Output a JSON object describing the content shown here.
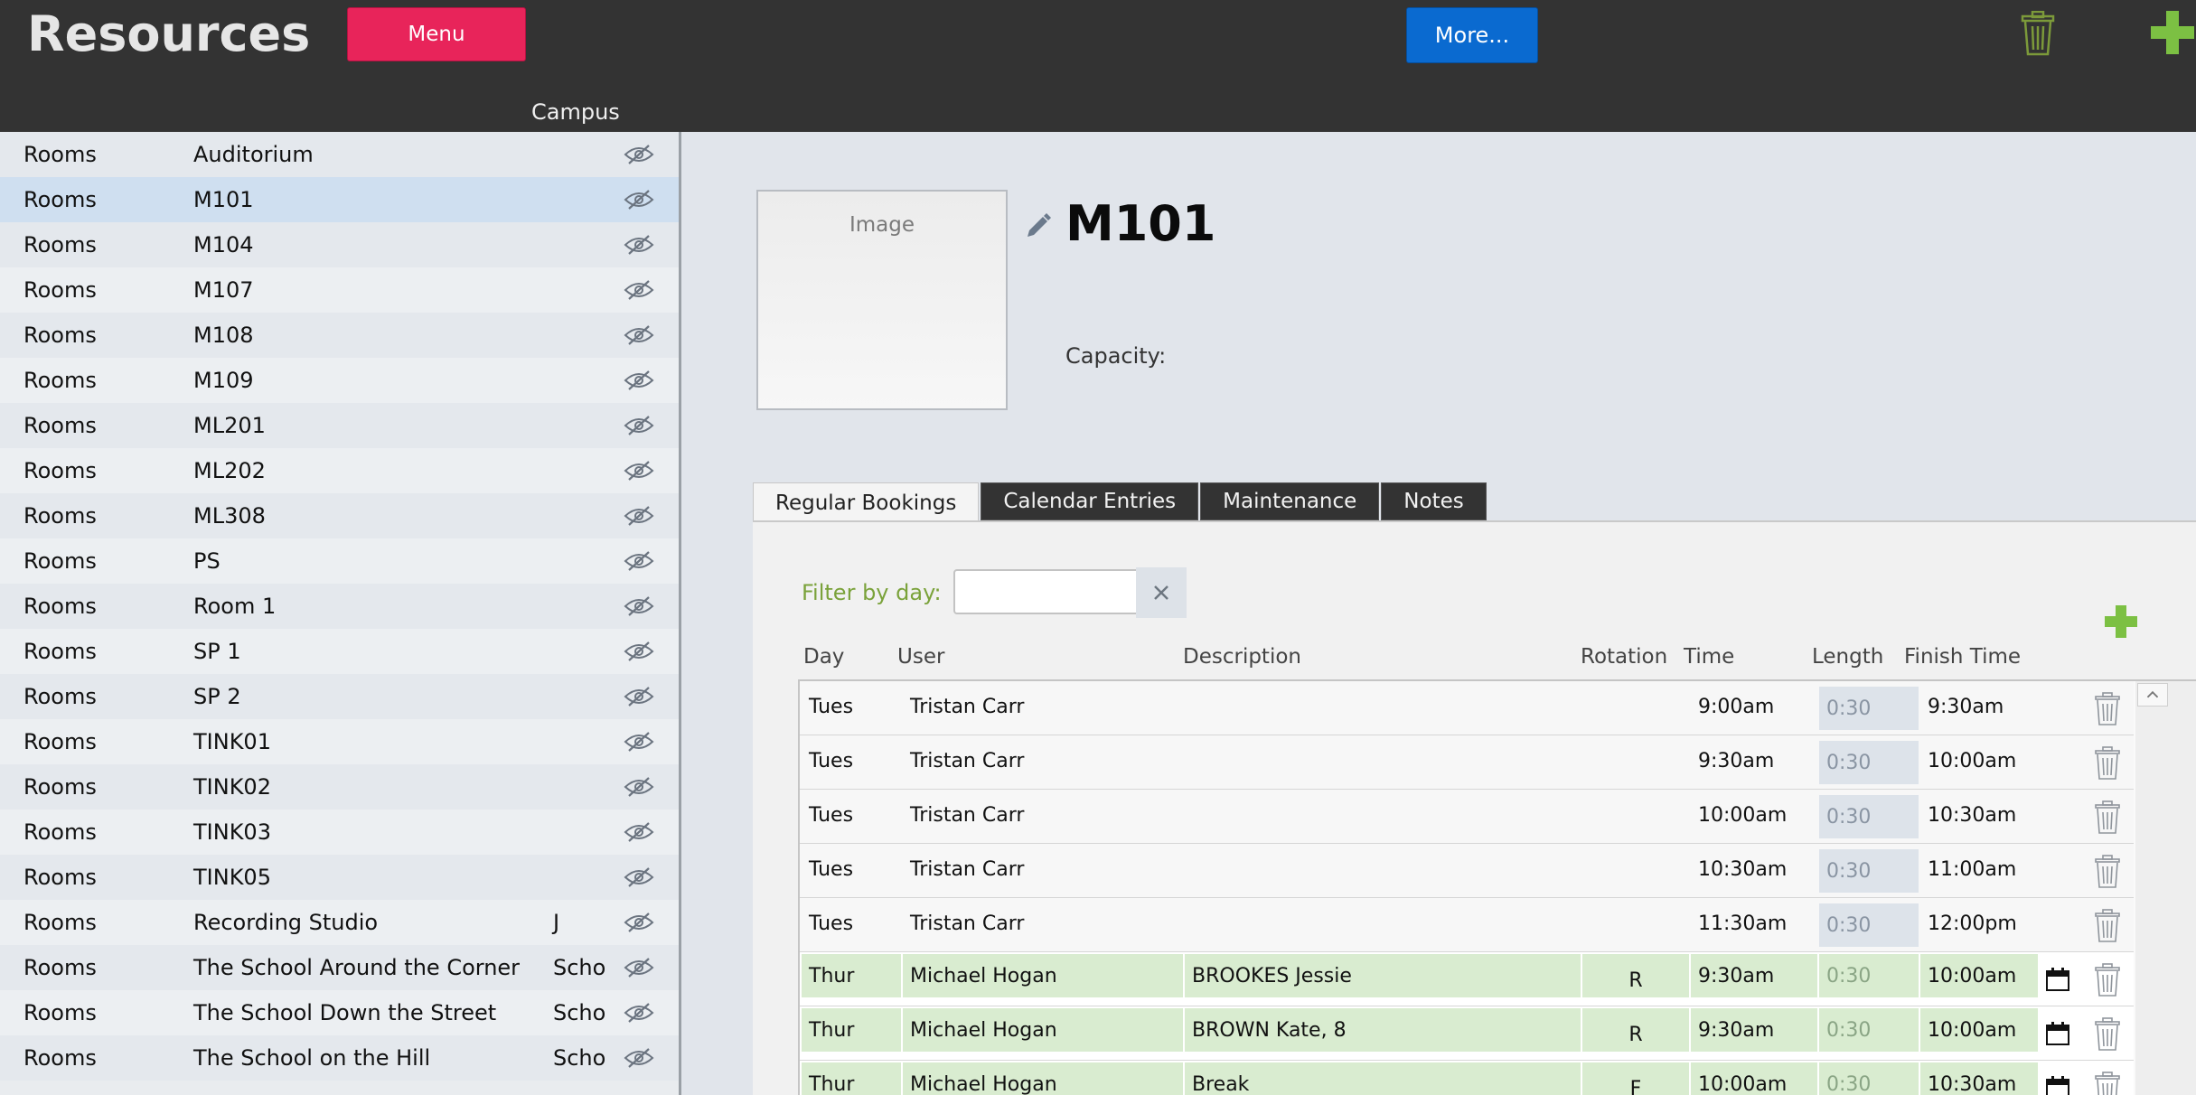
{
  "header": {
    "title": "Resources",
    "menu_label": "Menu",
    "more_label": "More...",
    "campus_column": "Campus",
    "colors": {
      "bar": "#333333",
      "menu": "#e8245a",
      "more": "#0a6ad0",
      "add": "#7cc043"
    }
  },
  "sidebar": {
    "items": [
      {
        "type": "Rooms",
        "name": "Auditorium",
        "campus": ""
      },
      {
        "type": "Rooms",
        "name": "M101",
        "campus": "",
        "selected": true
      },
      {
        "type": "Rooms",
        "name": "M104",
        "campus": ""
      },
      {
        "type": "Rooms",
        "name": "M107",
        "campus": ""
      },
      {
        "type": "Rooms",
        "name": "M108",
        "campus": ""
      },
      {
        "type": "Rooms",
        "name": "M109",
        "campus": ""
      },
      {
        "type": "Rooms",
        "name": "ML201",
        "campus": ""
      },
      {
        "type": "Rooms",
        "name": "ML202",
        "campus": ""
      },
      {
        "type": "Rooms",
        "name": "ML308",
        "campus": ""
      },
      {
        "type": "Rooms",
        "name": "PS",
        "campus": ""
      },
      {
        "type": "Rooms",
        "name": "Room 1",
        "campus": ""
      },
      {
        "type": "Rooms",
        "name": "SP 1",
        "campus": ""
      },
      {
        "type": "Rooms",
        "name": "SP 2",
        "campus": ""
      },
      {
        "type": "Rooms",
        "name": "TINK01",
        "campus": ""
      },
      {
        "type": "Rooms",
        "name": "TINK02",
        "campus": ""
      },
      {
        "type": "Rooms",
        "name": "TINK03",
        "campus": ""
      },
      {
        "type": "Rooms",
        "name": "TINK05",
        "campus": ""
      },
      {
        "type": "Rooms",
        "name": "Recording Studio",
        "campus": "J"
      },
      {
        "type": "Rooms",
        "name": "The School Around the Corner",
        "campus": "Scho"
      },
      {
        "type": "Rooms",
        "name": "The School Down the Street",
        "campus": "Scho"
      },
      {
        "type": "Rooms",
        "name": "The School on the Hill",
        "campus": "Scho"
      }
    ]
  },
  "detail": {
    "image_placeholder": "Image",
    "room_name": "M101",
    "capacity_label": "Capacity:",
    "tabs": [
      {
        "label": "Regular Bookings",
        "active": true
      },
      {
        "label": "Calendar Entries",
        "active": false
      },
      {
        "label": "Maintenance",
        "active": false
      },
      {
        "label": "Notes",
        "active": false
      }
    ],
    "filter_label": "Filter by day:",
    "filter_value": "",
    "columns": {
      "day": "Day",
      "user": "User",
      "description": "Description",
      "rotation": "Rotation",
      "time": "Time",
      "length": "Length",
      "finish": "Finish Time"
    },
    "bookings": [
      {
        "day": "Tues",
        "user": "Tristan Carr",
        "description": "",
        "rotation": "",
        "time": "9:00am",
        "length": "0:30",
        "finish": "9:30am",
        "highlight": false
      },
      {
        "day": "Tues",
        "user": "Tristan Carr",
        "description": "",
        "rotation": "",
        "time": "9:30am",
        "length": "0:30",
        "finish": "10:00am",
        "highlight": false
      },
      {
        "day": "Tues",
        "user": "Tristan Carr",
        "description": "",
        "rotation": "",
        "time": "10:00am",
        "length": "0:30",
        "finish": "10:30am",
        "highlight": false
      },
      {
        "day": "Tues",
        "user": "Tristan Carr",
        "description": "",
        "rotation": "",
        "time": "10:30am",
        "length": "0:30",
        "finish": "11:00am",
        "highlight": false
      },
      {
        "day": "Tues",
        "user": "Tristan Carr",
        "description": "",
        "rotation": "",
        "time": "11:30am",
        "length": "0:30",
        "finish": "12:00pm",
        "highlight": false
      },
      {
        "day": "Thur",
        "user": "Michael Hogan",
        "description": "BROOKES Jessie",
        "rotation": "R",
        "time": "9:30am",
        "length": "0:30",
        "finish": "10:00am",
        "highlight": true
      },
      {
        "day": "Thur",
        "user": "Michael Hogan",
        "description": "BROWN Kate, 8",
        "rotation": "R",
        "time": "9:30am",
        "length": "0:30",
        "finish": "10:00am",
        "highlight": true
      },
      {
        "day": "Thur",
        "user": "Michael Hogan",
        "description": "Break",
        "rotation": "F",
        "time": "10:00am",
        "length": "0:30",
        "finish": "10:30am",
        "highlight": true
      }
    ]
  }
}
